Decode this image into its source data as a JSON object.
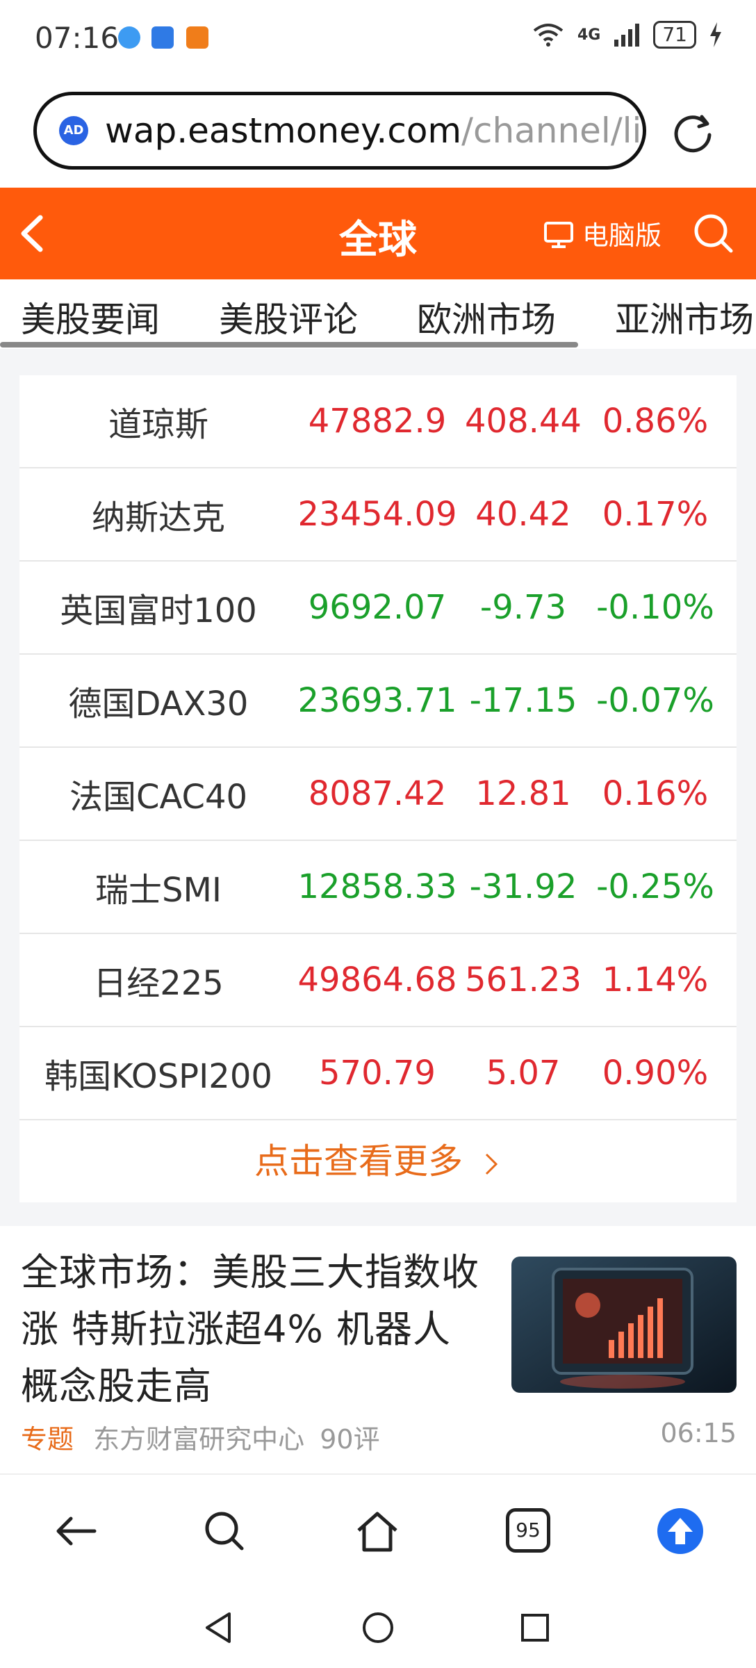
{
  "status_bar": {
    "time": "07:16",
    "network": "4G",
    "battery": "71"
  },
  "address_bar": {
    "badge": "AD",
    "url_host": "wap.eastmoney.com",
    "url_path": "/channel/lis"
  },
  "header": {
    "title": "全球",
    "pc_version": "电脑版"
  },
  "tabs": [
    "美股要闻",
    "美股评论",
    "欧洲市场",
    "亚洲市场"
  ],
  "indices": [
    {
      "name": "道琼斯",
      "price": "47882.9",
      "change": "408.44",
      "pct": "0.86%",
      "dir": "up"
    },
    {
      "name": "纳斯达克",
      "price": "23454.09",
      "change": "40.42",
      "pct": "0.17%",
      "dir": "up"
    },
    {
      "name": "英国富时100",
      "price": "9692.07",
      "change": "-9.73",
      "pct": "-0.10%",
      "dir": "down"
    },
    {
      "name": "德国DAX30",
      "price": "23693.71",
      "change": "-17.15",
      "pct": "-0.07%",
      "dir": "down"
    },
    {
      "name": "法国CAC40",
      "price": "8087.42",
      "change": "12.81",
      "pct": "0.16%",
      "dir": "up"
    },
    {
      "name": "瑞士SMI",
      "price": "12858.33",
      "change": "-31.92",
      "pct": "-0.25%",
      "dir": "down"
    },
    {
      "name": "日经225",
      "price": "49864.68",
      "change": "561.23",
      "pct": "1.14%",
      "dir": "up"
    },
    {
      "name": "韩国KOSPI200",
      "price": "570.79",
      "change": "5.07",
      "pct": "0.90%",
      "dir": "up"
    }
  ],
  "more_link": "点击查看更多",
  "news": {
    "title": "全球市场：美股三大指数收涨 特斯拉涨超4% 机器人概念股走高",
    "tag": "专题",
    "source": "东方财富研究中心",
    "comments": "90评",
    "time": "06:15"
  },
  "bottom_bar": {
    "tabs_count": "95"
  },
  "colors": {
    "brand_orange": "#ff5a0c",
    "up_red": "#e0282f",
    "down_green": "#1aa02a",
    "link_orange": "#e86b1a",
    "upload_blue": "#1e6cf0"
  }
}
